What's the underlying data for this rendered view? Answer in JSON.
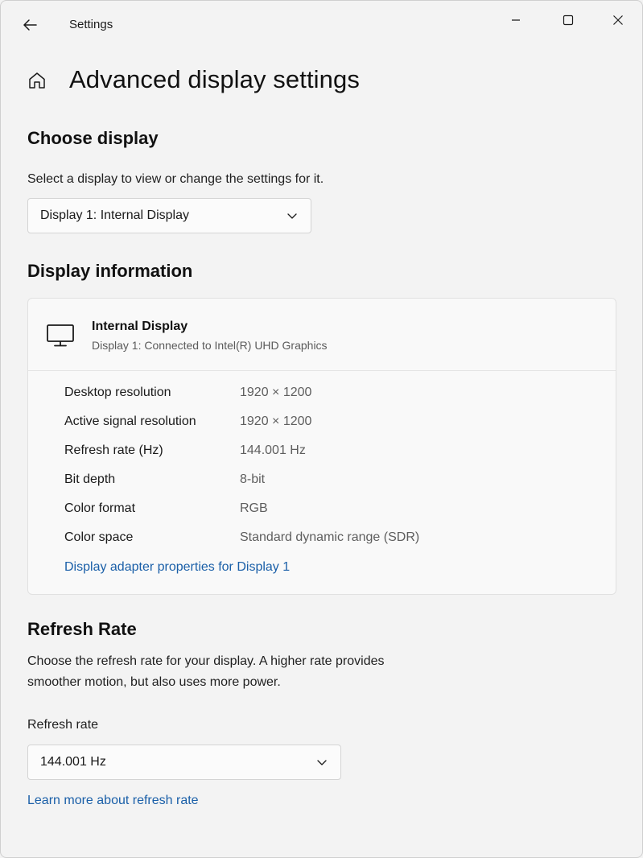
{
  "titlebar": {
    "app_title": "Settings"
  },
  "page": {
    "title": "Advanced display settings"
  },
  "choose_display": {
    "heading": "Choose display",
    "description": "Select a display to view or change the settings for it.",
    "selected": "Display 1: Internal Display"
  },
  "display_information": {
    "heading": "Display information",
    "display_name": "Internal Display",
    "display_subtitle": "Display 1: Connected to Intel(R) UHD Graphics",
    "rows": [
      {
        "label": "Desktop resolution",
        "value": "1920 × 1200"
      },
      {
        "label": "Active signal resolution",
        "value": "1920 × 1200"
      },
      {
        "label": "Refresh rate (Hz)",
        "value": "144.001 Hz"
      },
      {
        "label": "Bit depth",
        "value": "8-bit"
      },
      {
        "label": "Color format",
        "value": "RGB"
      },
      {
        "label": "Color space",
        "value": "Standard dynamic range (SDR)"
      }
    ],
    "adapter_link": "Display adapter properties for Display 1"
  },
  "refresh_rate": {
    "heading": "Refresh Rate",
    "description_line1": "Choose the refresh rate for your display. A higher rate provides",
    "description_line2": "smoother motion, but also uses more power.",
    "field_label": "Refresh rate",
    "selected": "144.001 Hz",
    "learn_more_link": "Learn more about refresh rate"
  },
  "colors": {
    "background": "#f3f3f3",
    "card": "#f9f9f9",
    "link": "#1a5fa8"
  }
}
